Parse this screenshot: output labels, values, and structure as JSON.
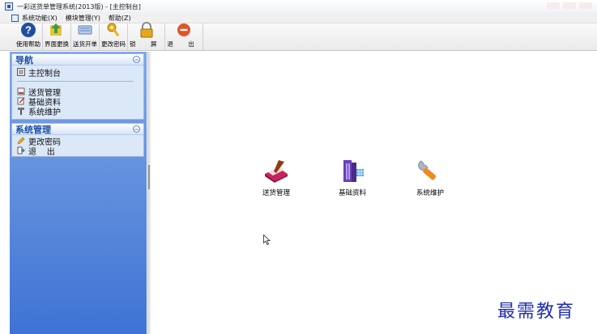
{
  "window": {
    "title": "一彩送货单管理系统(2013版) - [主控制台]"
  },
  "menubar": {
    "items": [
      "系统功能(X)",
      "模块管理(Y)",
      "帮助(Z)"
    ]
  },
  "toolbar": {
    "buttons": [
      {
        "label": "使用帮助",
        "icon": "help-icon"
      },
      {
        "label": "界面更换",
        "icon": "change-ui-icon"
      },
      {
        "label": "送货开单",
        "icon": "delivery-order-icon"
      },
      {
        "label": "更改密码",
        "icon": "key-icon"
      },
      {
        "label": "锁 屏",
        "icon": "lock-icon"
      },
      {
        "label": "退 出",
        "icon": "exit-icon"
      }
    ]
  },
  "sidebar": {
    "nav": {
      "title": "导航",
      "items": [
        {
          "label": "主控制台",
          "icon": "console-icon"
        },
        {
          "label": "送货管理",
          "icon": "delivery-icon"
        },
        {
          "label": "基础资料",
          "icon": "basic-data-icon"
        },
        {
          "label": "系统维护",
          "icon": "maintenance-icon"
        }
      ]
    },
    "system": {
      "title": "系统管理",
      "items": [
        {
          "label": "更改密码",
          "icon": "pencil-icon"
        },
        {
          "label": "退    出",
          "icon": "exit-icon"
        }
      ]
    }
  },
  "main": {
    "modules": [
      {
        "label": "送货管理",
        "icon": "delivery-book-icon"
      },
      {
        "label": "基础资料",
        "icon": "building-icon"
      },
      {
        "label": "系统维护",
        "icon": "wrench-icon"
      }
    ]
  },
  "watermark": "最需教育",
  "colors": {
    "panel_blue": "#3f73d4",
    "group_bg": "#dbe8f8",
    "title_blue": "#1b4fa8",
    "watermark": "#1f2fb0"
  }
}
